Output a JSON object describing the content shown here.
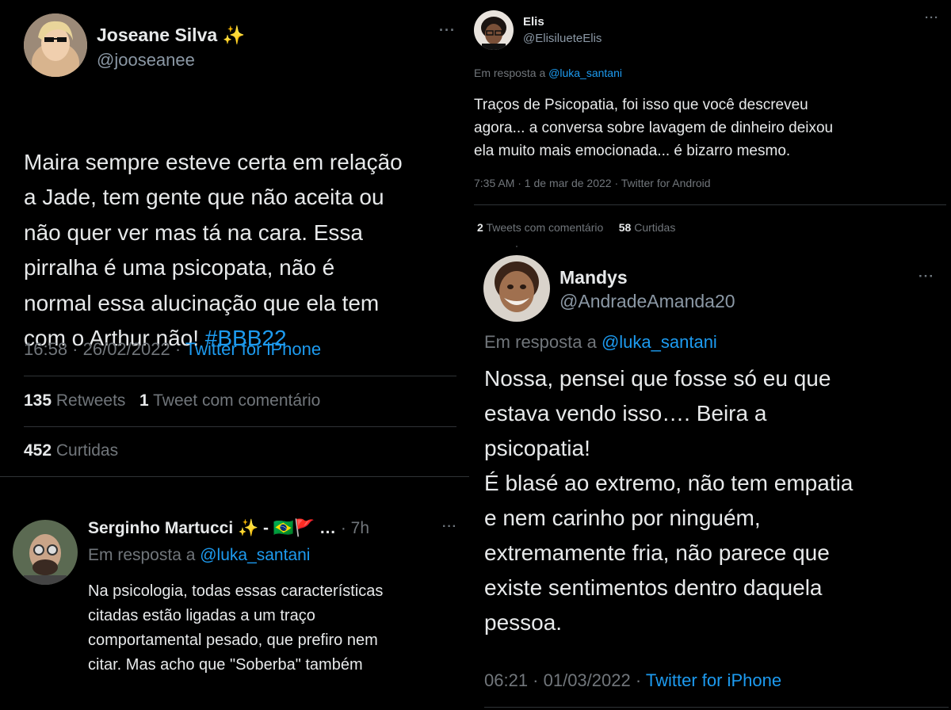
{
  "tweet1": {
    "name": "Joseane Silva",
    "name_emoji": "✨",
    "handle": "@jooseanee",
    "text": "Maira sempre esteve certa em relação\na Jade, tem gente que não aceita ou\nnão quer ver mas tá na cara. Essa\npirralha é uma psicopata, não é\nnormal essa alucinação que ela tem\ncom o Arthur não! ",
    "hashtag": "#BBB22",
    "time": "16:58 · 26/02/2022 · ",
    "client": "Twitter for iPhone",
    "retweets_count": "135",
    "retweets_label": "Retweets",
    "quotes_count": "1",
    "quotes_label": "Tweet com comentário",
    "likes_count": "452",
    "likes_label": "Curtidas"
  },
  "reply1": {
    "name": "Serginho Martucci",
    "name_suffix": "✨ - 🇧🇷🚩 …",
    "age": "· 7h",
    "reply_prefix": "Em resposta a ",
    "reply_to": "@luka_santani",
    "text": "Na psicologia, todas essas características\ncitadas estão ligadas a um traço\ncomportamental pesado, que prefiro nem\ncitar. Mas acho que \"Soberba\" também"
  },
  "tweet2": {
    "name": "Elis",
    "handle": "@ElisilueteElis",
    "reply_prefix": "Em resposta a ",
    "reply_to": "@luka_santani",
    "text": "Traços de Psicopatia, foi isso que você descreveu\nagora... a conversa sobre lavagem de dinheiro deixou\nela muito mais emocionada... é bizarro mesmo.",
    "meta": "7:35 AM · 1 de mar de 2022 · Twitter for Android",
    "quotes_count": "2",
    "quotes_label": "Tweets com comentário",
    "likes_count": "58",
    "likes_label": "Curtidas"
  },
  "tweet3": {
    "name": "Mandys",
    "handle": "@AndradeAmanda20",
    "reply_prefix": "Em resposta a ",
    "reply_to": "@luka_santani",
    "text": "Nossa, pensei que fosse só eu que\nestava vendo isso…. Beira a\npsicopatia!\nÉ blasé ao extremo, não tem empatia\ne nem carinho por ninguém,\nextremamente fria, não parece que\nexiste sentimentos dentro daquela\npessoa.",
    "time": "06:21 · 01/03/2022 · ",
    "client": "Twitter for iPhone"
  },
  "more_label": "···",
  "colors": {
    "background": "#000000",
    "text": "#e7e9ea",
    "muted": "#71767b",
    "link": "#1d9bf0",
    "divider": "#2f3336"
  }
}
